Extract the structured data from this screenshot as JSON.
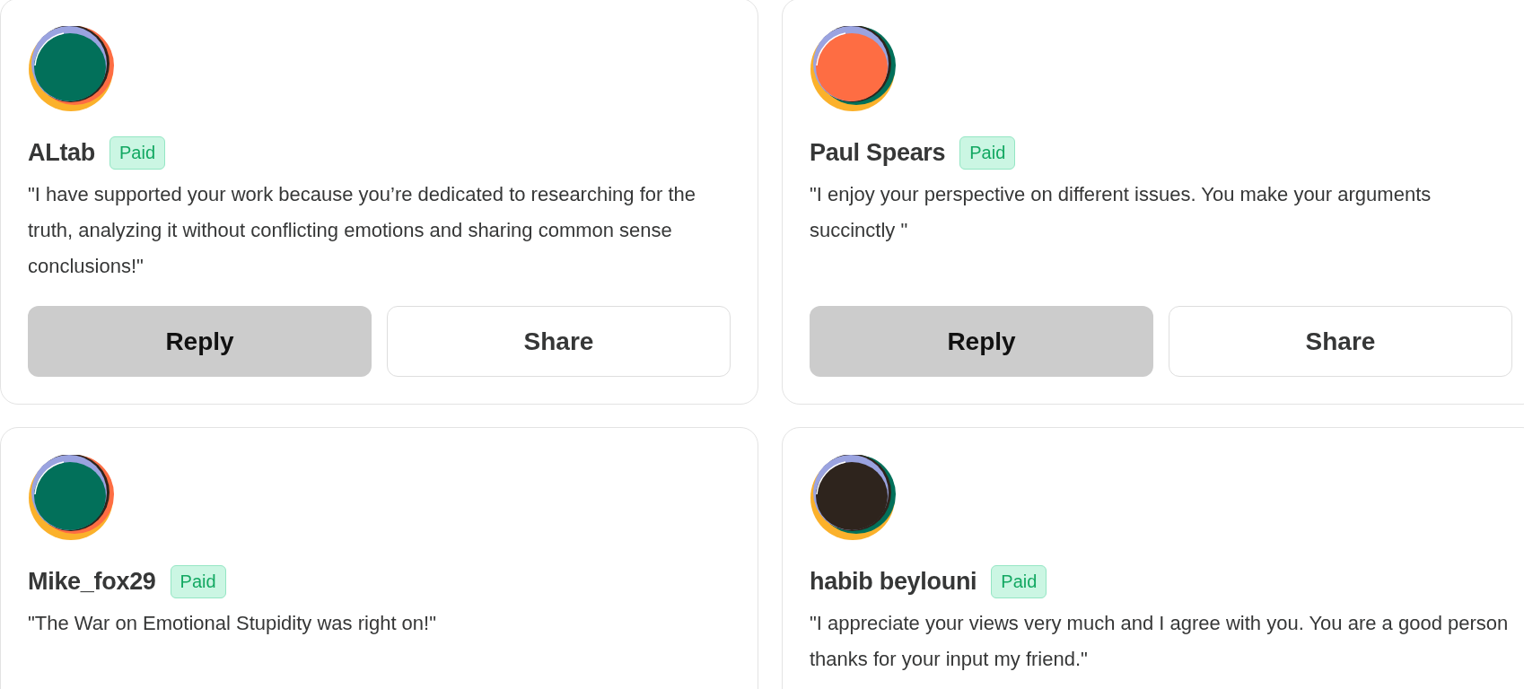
{
  "comments": [
    {
      "name": "ALtab",
      "badge": "Paid",
      "color": "#02705a",
      "quote": "\"I have supported your work because you’re dedicated to researching for the truth, analyzing it without conflicting emotions and sharing common sense conclusions!\"",
      "buttons": [
        {
          "label": "Reply",
          "kind": "primary"
        },
        {
          "label": "Share",
          "kind": "secondary"
        }
      ]
    },
    {
      "name": "Paul Spears",
      "badge": "Paid",
      "color": "#fe6d43",
      "quote": "\"I enjoy your perspective on different issues. You make your arguments succinctly \"",
      "buttons": [
        {
          "label": "Reply",
          "kind": "primary"
        },
        {
          "label": "Share",
          "kind": "secondary"
        }
      ]
    },
    {
      "name": "Mike_fox29",
      "badge": "Paid",
      "color": "#02705a",
      "quote": "\"The War on Emotional Stupidity was right on!\""
    },
    {
      "name": "habib beylouni",
      "badge": "Paid",
      "color": "#2e241d",
      "quote": "\"I appreciate your views very much and I agree with you. You are a good person thanks for your input my friend.\""
    }
  ]
}
